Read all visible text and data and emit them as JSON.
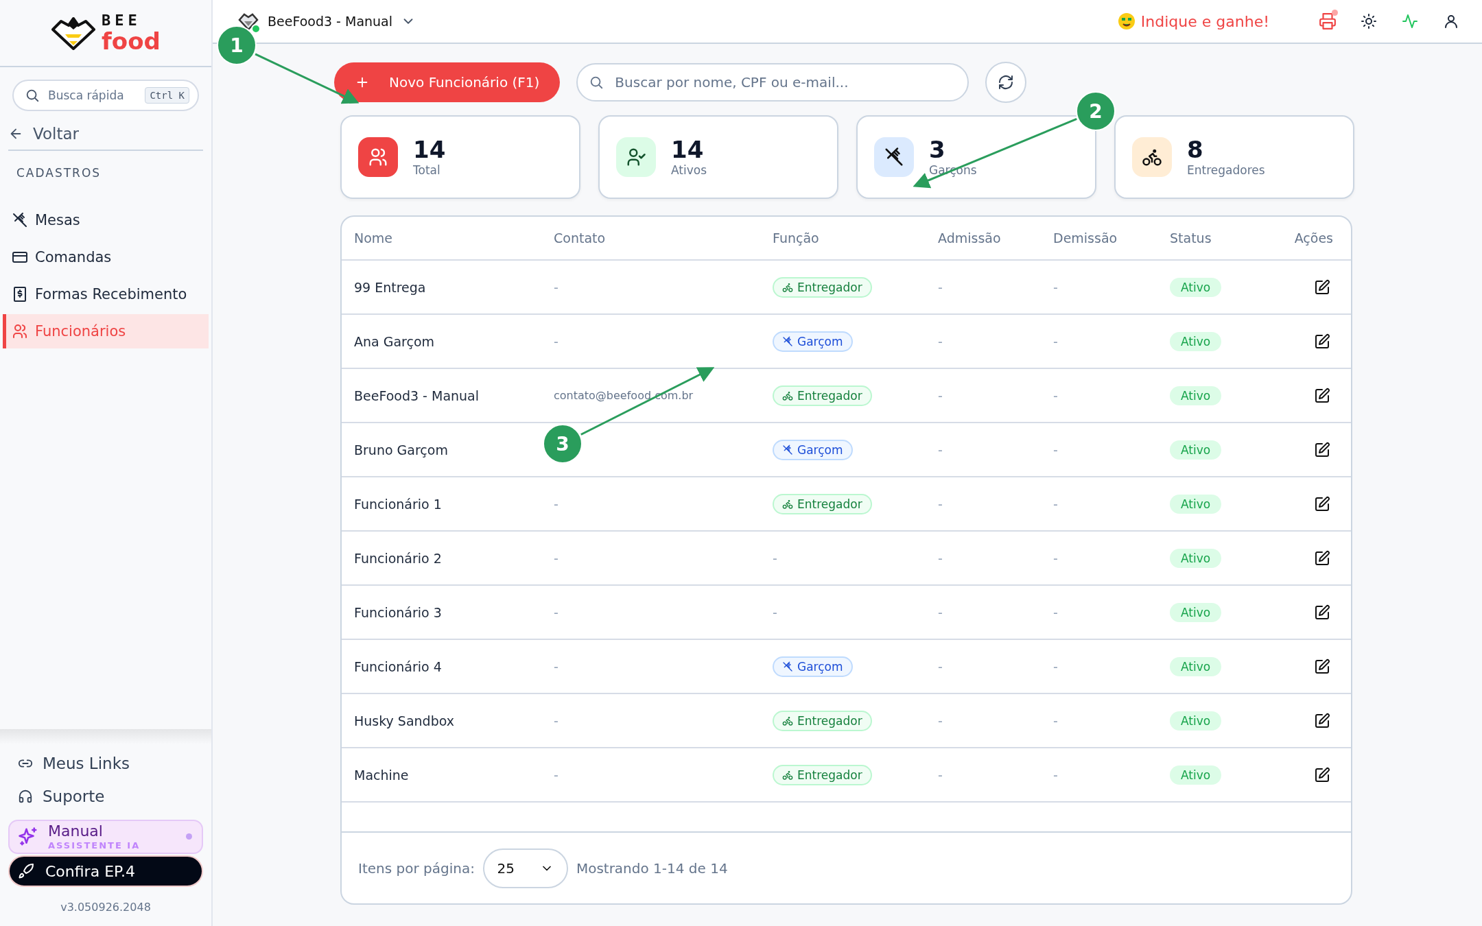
{
  "sidebar": {
    "logo": {
      "top": "BEE",
      "bottom": "food"
    },
    "quick_search": {
      "placeholder": "Busca rápida",
      "shortcut": "Ctrl K"
    },
    "back": "Voltar",
    "section": "CADASTROS",
    "nav": [
      {
        "label": "Mesas",
        "selected": false
      },
      {
        "label": "Comandas",
        "selected": false
      },
      {
        "label": "Formas Recebimento",
        "selected": false
      },
      {
        "label": "Funcionários",
        "selected": true
      }
    ],
    "footer_links": [
      {
        "label": "Meus Links"
      },
      {
        "label": "Suporte"
      }
    ],
    "assistant": {
      "title": "Manual",
      "subtitle": "ASSISTENTE IA"
    },
    "promo": "Confira EP.4",
    "version": "v3.050926.2048"
  },
  "header": {
    "store": "BeeFood3 - Manual",
    "referral": "Indique e ganhe!"
  },
  "toolbar": {
    "new_button": "Novo Funcionário (F1)",
    "search": {
      "placeholder": "Buscar por nome, CPF ou e-mail..."
    }
  },
  "stats": [
    {
      "value": "14",
      "label": "Total",
      "color": "#ef4444"
    },
    {
      "value": "14",
      "label": "Ativos",
      "color": "#dcfce7"
    },
    {
      "value": "3",
      "label": "Garçons",
      "color": "#dbeafe"
    },
    {
      "value": "8",
      "label": "Entregadores",
      "color": "#ffedd5"
    }
  ],
  "table": {
    "columns": [
      "Nome",
      "Contato",
      "Função",
      "Admissão",
      "Demissão",
      "Status",
      "Ações"
    ],
    "rows": [
      {
        "name": "99 Entrega",
        "contact": "-",
        "role": {
          "kind": "delivery",
          "label": "Entregador"
        },
        "admission": "-",
        "dismissal": "-",
        "status": "Ativo"
      },
      {
        "name": "Ana Garçom",
        "contact": "-",
        "role": {
          "kind": "waiter",
          "label": "Garçom"
        },
        "admission": "-",
        "dismissal": "-",
        "status": "Ativo"
      },
      {
        "name": "BeeFood3 - Manual",
        "contact": "contato@beefood.com.br",
        "role": {
          "kind": "delivery",
          "label": "Entregador"
        },
        "admission": "-",
        "dismissal": "-",
        "status": "Ativo"
      },
      {
        "name": "Bruno Garçom",
        "contact": "",
        "role": {
          "kind": "waiter",
          "label": "Garçom"
        },
        "admission": "-",
        "dismissal": "-",
        "status": "Ativo"
      },
      {
        "name": "Funcionário 1",
        "contact": "-",
        "role": {
          "kind": "delivery",
          "label": "Entregador"
        },
        "admission": "-",
        "dismissal": "-",
        "status": "Ativo"
      },
      {
        "name": "Funcionário 2",
        "contact": "-",
        "role": {
          "kind": "none",
          "label": "-"
        },
        "admission": "-",
        "dismissal": "-",
        "status": "Ativo"
      },
      {
        "name": "Funcionário 3",
        "contact": "-",
        "role": {
          "kind": "none",
          "label": "-"
        },
        "admission": "-",
        "dismissal": "-",
        "status": "Ativo"
      },
      {
        "name": "Funcionário 4",
        "contact": "-",
        "role": {
          "kind": "waiter",
          "label": "Garçom"
        },
        "admission": "-",
        "dismissal": "-",
        "status": "Ativo"
      },
      {
        "name": "Husky Sandbox",
        "contact": "-",
        "role": {
          "kind": "delivery",
          "label": "Entregador"
        },
        "admission": "-",
        "dismissal": "-",
        "status": "Ativo"
      },
      {
        "name": "Machine",
        "contact": "-",
        "role": {
          "kind": "delivery",
          "label": "Entregador"
        },
        "admission": "-",
        "dismissal": "-",
        "status": "Ativo"
      }
    ]
  },
  "pagination": {
    "label": "Itens por página:",
    "page_size": "25",
    "summary": "Mostrando 1-14 de 14"
  },
  "annotations": [
    {
      "label": "1"
    },
    {
      "label": "2"
    },
    {
      "label": "3"
    }
  ]
}
